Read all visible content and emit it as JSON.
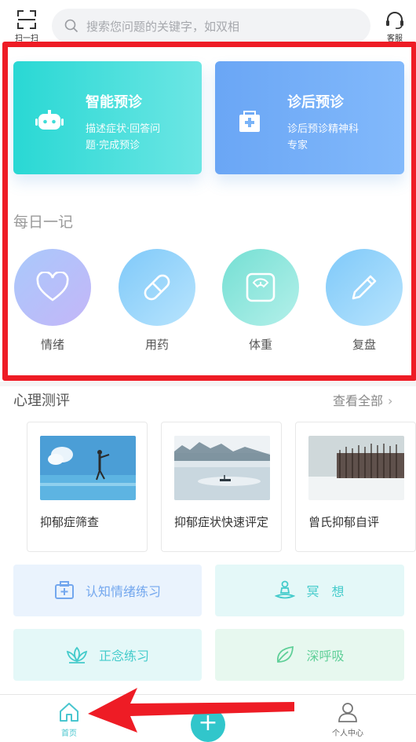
{
  "topbar": {
    "scan_label": "扫一扫",
    "search_placeholder": "搜索您问题的关键字，如双相",
    "service_label": "客服"
  },
  "cards": [
    {
      "title": "智能预诊",
      "desc": "描述症状·回答问题·完成预诊",
      "icon": "robot-icon"
    },
    {
      "title": "诊后预诊",
      "desc": "诊后预诊精神科专家",
      "icon": "medical-kit-icon"
    }
  ],
  "daily": {
    "title": "每日一记",
    "items": [
      {
        "label": "情绪",
        "icon": "heart-icon"
      },
      {
        "label": "用药",
        "icon": "pill-icon"
      },
      {
        "label": "体重",
        "icon": "scale-icon"
      },
      {
        "label": "复盘",
        "icon": "pencil-icon"
      }
    ]
  },
  "psych": {
    "title": "心理测评",
    "view_all": "查看全部",
    "tests": [
      {
        "title": "抑郁症筛查"
      },
      {
        "title": "抑郁症状快速评定"
      },
      {
        "title": "曾氏抑郁自评"
      }
    ]
  },
  "practice": [
    {
      "label": "认知情绪练习",
      "icon": "first-aid-kit-icon"
    },
    {
      "label": "冥　想",
      "icon": "meditation-icon"
    },
    {
      "label": "正念练习",
      "icon": "lotus-icon"
    },
    {
      "label": "深呼吸",
      "icon": "leaf-icon"
    }
  ],
  "nav": {
    "home_label": "首页",
    "plus_label": "+",
    "me_label": "个人中心"
  },
  "colors": {
    "accent": "#31c6cb",
    "highlight": "#ee1c25"
  }
}
